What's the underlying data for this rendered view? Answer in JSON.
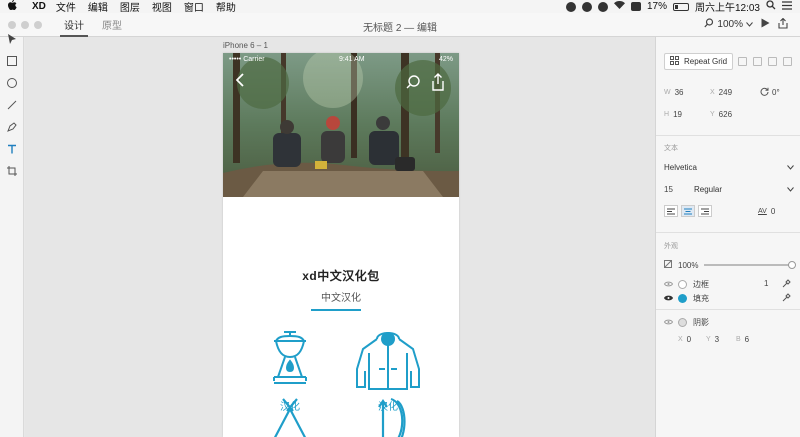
{
  "menubar": {
    "app_name": "XD",
    "items": [
      "文件",
      "编辑",
      "图层",
      "视图",
      "窗口",
      "帮助"
    ],
    "battery": "17%",
    "datetime": "周六上午12:03"
  },
  "toolbar": {
    "tabs": [
      "设计",
      "原型"
    ],
    "document_title": "无标题 2 — 编辑",
    "zoom": "100%"
  },
  "artboard": {
    "label": "iPhone 6 – 1",
    "status_carrier": "••••• Carrier",
    "status_time": "9:41 AM",
    "status_battery": "42%",
    "title": "xd中文汉化包",
    "subtitle": "中文汉化",
    "grid": [
      {
        "label": "汉化",
        "icon": "lantern-icon"
      },
      {
        "label": "汉化",
        "icon": "jacket-icon"
      },
      {
        "label": "",
        "icon": "tent-icon"
      },
      {
        "label": "",
        "icon": "bow-arrow-icon"
      }
    ],
    "accent": "#1f9ec9"
  },
  "panel": {
    "repeat_grid": "Repeat Grid",
    "w": "36",
    "x": "249",
    "rotation": "0°",
    "h": "19",
    "y": "626",
    "text_section": "文本",
    "font": "Helvetica",
    "font_size": "15",
    "font_weight": "Regular",
    "letter_spacing_label": "AV",
    "letter_spacing": "0",
    "appearance_section": "外观",
    "opacity": "100%",
    "border_label": "边框",
    "border_width": "1",
    "fill_label": "填充",
    "fill_color": "#1f9ec9",
    "shadow_label": "阴影",
    "shadow_x": "0",
    "shadow_y": "3",
    "shadow_b": "6"
  }
}
